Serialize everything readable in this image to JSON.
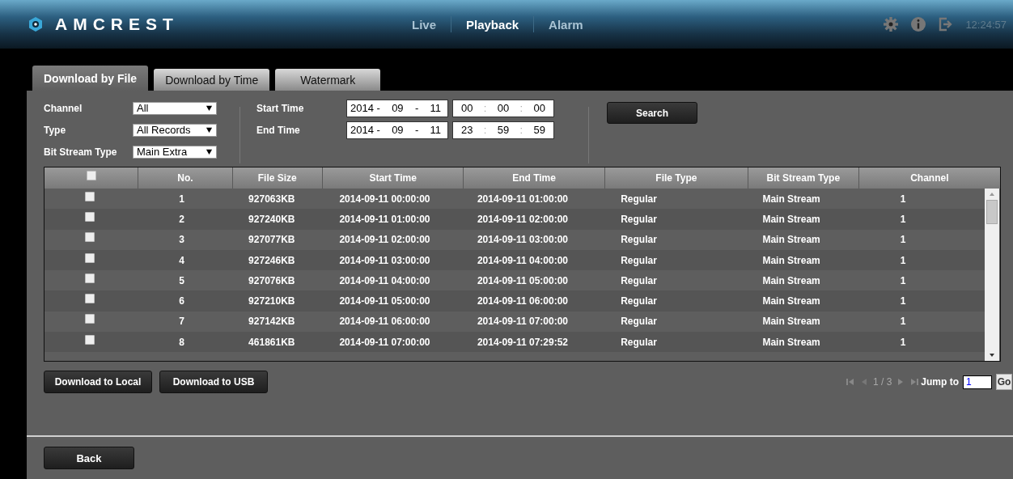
{
  "header": {
    "brand": "AMCREST",
    "nav": [
      {
        "label": "Live",
        "selected": false
      },
      {
        "label": "Playback",
        "selected": true
      },
      {
        "label": "Alarm",
        "selected": false
      }
    ],
    "clock": "12:24:57"
  },
  "tabs": [
    {
      "label": "Download by File",
      "selected": true
    },
    {
      "label": "Download by Time",
      "selected": false
    },
    {
      "label": "Watermark",
      "selected": false
    }
  ],
  "filters": [
    {
      "label": "Channel",
      "value": "All"
    },
    {
      "label": "Type",
      "value": "All Records"
    },
    {
      "label": "Bit Stream Type",
      "value": "Main Extra"
    }
  ],
  "times": [
    {
      "label": "Start Time",
      "date": [
        "2014 -",
        "09",
        "-",
        "11"
      ],
      "time": [
        "00",
        ":",
        "00",
        ":",
        "00"
      ]
    },
    {
      "label": "End Time",
      "date": [
        "2014 -",
        "09",
        "-",
        "11"
      ],
      "time": [
        "23",
        ":",
        "59",
        ":",
        "59"
      ]
    }
  ],
  "search_button": "Search",
  "table": {
    "all_selected": false,
    "columns": [
      "No.",
      "File Size",
      "Start Time",
      "End Time",
      "File Type",
      "Bit Stream Type",
      "Channel"
    ],
    "rows": [
      {
        "selected": false,
        "cells": [
          "1",
          "927063KB",
          "2014-09-11 00:00:00",
          "2014-09-11 01:00:00",
          "Regular",
          "Main Stream",
          "1"
        ]
      },
      {
        "selected": false,
        "cells": [
          "2",
          "927240KB",
          "2014-09-11 01:00:00",
          "2014-09-11 02:00:00",
          "Regular",
          "Main Stream",
          "1"
        ]
      },
      {
        "selected": false,
        "cells": [
          "3",
          "927077KB",
          "2014-09-11 02:00:00",
          "2014-09-11 03:00:00",
          "Regular",
          "Main Stream",
          "1"
        ]
      },
      {
        "selected": false,
        "cells": [
          "4",
          "927246KB",
          "2014-09-11 03:00:00",
          "2014-09-11 04:00:00",
          "Regular",
          "Main Stream",
          "1"
        ]
      },
      {
        "selected": false,
        "cells": [
          "5",
          "927076KB",
          "2014-09-11 04:00:00",
          "2014-09-11 05:00:00",
          "Regular",
          "Main Stream",
          "1"
        ]
      },
      {
        "selected": false,
        "cells": [
          "6",
          "927210KB",
          "2014-09-11 05:00:00",
          "2014-09-11 06:00:00",
          "Regular",
          "Main Stream",
          "1"
        ]
      },
      {
        "selected": false,
        "cells": [
          "7",
          "927142KB",
          "2014-09-11 06:00:00",
          "2014-09-11 07:00:00",
          "Regular",
          "Main Stream",
          "1"
        ]
      },
      {
        "selected": false,
        "cells": [
          "8",
          "461861KB",
          "2014-09-11 07:00:00",
          "2014-09-11 07:29:52",
          "Regular",
          "Main Stream",
          "1"
        ]
      }
    ]
  },
  "actions": [
    "Download to Local",
    "Download to USB"
  ],
  "pager": {
    "page": "1 / 3",
    "jump_label": "Jump to",
    "jump_value": "1",
    "go": "Go"
  },
  "back_button": "Back"
}
